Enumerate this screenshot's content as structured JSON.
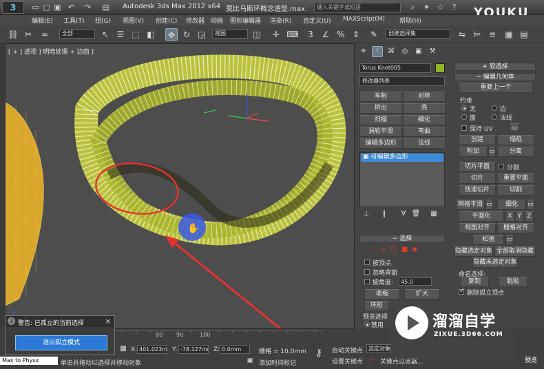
{
  "titlebar": {
    "app_title": "Autodesk 3ds Max  2012 x64",
    "file_title": "莫比乌斯环概念造型.max",
    "search_placeholder": "键入关键字或短语",
    "logo_text": "3",
    "watermark_brand": "YOUKU"
  },
  "menu": [
    "编辑(E)",
    "工具(T)",
    "组(G)",
    "视图(V)",
    "创建(C)",
    "修改器",
    "动画",
    "图形编辑器",
    "渲染(R)",
    "自定义(U)",
    "MAXScript(M)",
    "帮助(H)"
  ],
  "toolbar": {
    "selection_filter": "全部",
    "reference_coord": "视图",
    "named_selection": "创建选择集"
  },
  "viewport": {
    "label": "[ + ] 透视 ] 明暗处理 + 边面 ]"
  },
  "command_panel": {
    "object_name": "Torus Knot005",
    "object_color": "#8cb426",
    "modifier_list": "修改器列表",
    "modifier_buttons": [
      "车削",
      "对称",
      "挤出",
      "壳",
      "扫描",
      "细化",
      "涡轮平滑",
      "弯曲",
      "编辑多边形",
      "法线"
    ],
    "stack_item": "可编辑多边形",
    "selection_rollout": "选择",
    "by_vertex": "按顶点",
    "ignore_backfacing": "忽略背面",
    "by_angle": "按角度:",
    "angle_value": "45.0",
    "shrink": "收缩",
    "grow": "扩大",
    "ring": "环形",
    "preview_selection": "预览选择",
    "preview_disabled": "禁用"
  },
  "right_panel": {
    "soft_selection": "软选择",
    "edit_geometry": "编辑几何体",
    "repeat_last": "重复上一个",
    "constraints": "约束",
    "c_none": "无",
    "c_edge": "边",
    "c_face": "面",
    "c_normal": "法线",
    "preserve_uv": "保持 UV",
    "create": "创建",
    "collapse": "塌陷",
    "attach": "附加",
    "detach": "分离",
    "slice_plane": "切片平面",
    "split": "分割",
    "slice": "切片",
    "reset_plane": "重置平面",
    "quickslice": "快速切片",
    "cut": "切割",
    "meshsmooth": "网格平滑",
    "tessellate": "细化",
    "make_planar": "平面化",
    "x": "X",
    "y": "Y",
    "z": "Z",
    "view_align": "视图对齐",
    "grid_align": "栅格对齐",
    "relax": "松弛",
    "hide_selected": "隐藏选定对象",
    "unhide_all": "全部取消隐藏",
    "hide_unselected": "隐藏未选定对象",
    "named_selections": "命名选择:",
    "copy": "复制",
    "paste": "粘贴",
    "delete_isolated": "删除孤立顶点"
  },
  "status": {
    "x_label": "X:",
    "x_value": "401.023mr",
    "y_label": "Y:",
    "y_value": "-78.127mm",
    "z_label": "Z:",
    "z_value": "0.0mm",
    "grid": "栅格 = 10.0mm",
    "prompt": "单击并拖动以选择并移动对象",
    "add_time_tag": "添加时间标记",
    "auto_key": "自动关键点",
    "selected_obj": "选定对象",
    "set_key": "设置关键点",
    "key_filters": "关键点过滤器...",
    "preview": "预览",
    "max_to_physx": "Max to Physx",
    "timeline_ticks": [
      "80",
      "90",
      "100"
    ]
  },
  "dialog": {
    "title": "警告: 已孤立的当前选择",
    "close": "×",
    "exit_isolation": "退出孤立模式"
  },
  "watermark": {
    "name": "溜溜自学",
    "url": "ZIXUE.3D66.COM"
  }
}
